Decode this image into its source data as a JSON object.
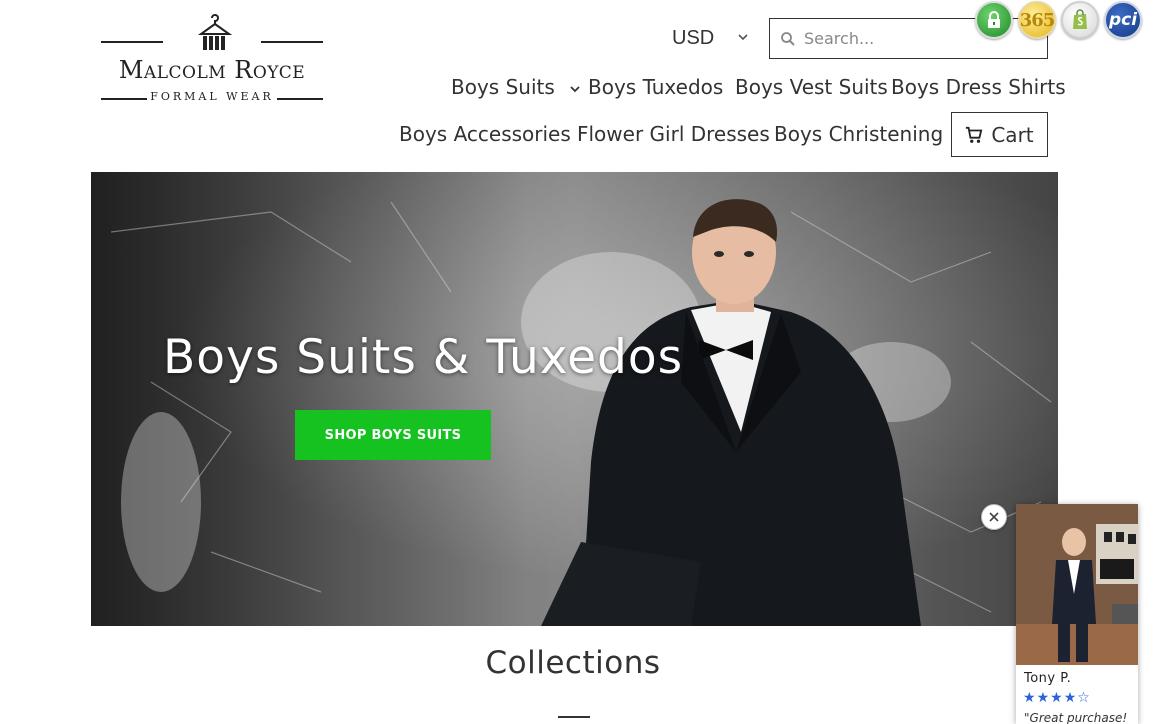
{
  "logo": {
    "brand": "Malcolm Royce",
    "tagline": "FORMAL WEAR",
    "icon": "hanger-icon"
  },
  "currency": {
    "selected": "USD",
    "icon": "chevron-down-icon"
  },
  "search": {
    "placeholder": "Search...",
    "icon": "search-icon"
  },
  "badges": [
    {
      "name": "secure-lock-badge",
      "icon": "lock-icon",
      "color": "#2ea633"
    },
    {
      "name": "365-badge",
      "label": "365",
      "color": "#e5b319"
    },
    {
      "name": "shopify-badge",
      "icon": "shopify-bag-icon",
      "color": "#95bf47"
    },
    {
      "name": "pci-badge",
      "label": "pci",
      "color": "#1b4596"
    }
  ],
  "nav": {
    "row1": [
      {
        "label": "Boys Suits",
        "has_dropdown": true
      },
      {
        "label": "Boys Tuxedos"
      },
      {
        "label": "Boys Vest Suits"
      },
      {
        "label": "Boys Dress Shirts"
      }
    ],
    "row2": [
      {
        "label": "Boys Accessories"
      },
      {
        "label": "Flower Girl Dresses"
      },
      {
        "label": "Boys Christening"
      }
    ],
    "cart": {
      "label": "Cart",
      "icon": "cart-icon"
    }
  },
  "hero": {
    "title": "Boys Suits & Tuxedos",
    "cta": "SHOP BOYS SUITS",
    "cta_color": "#15c21f"
  },
  "collections": {
    "title": "Collections"
  },
  "review": {
    "name": "Tony P.",
    "rating": 4,
    "max_rating": 5,
    "quote": "\"Great purchase!",
    "star_color": "#2b62d9"
  }
}
